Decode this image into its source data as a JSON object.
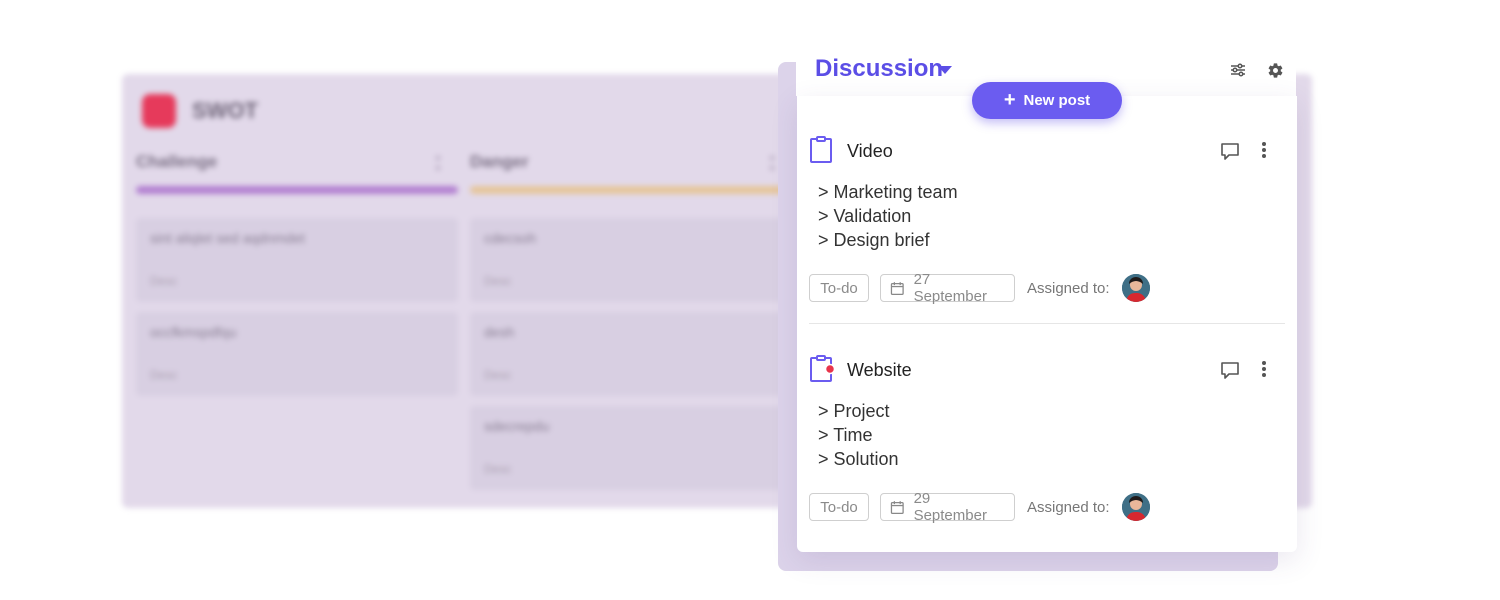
{
  "background_board": {
    "title": "SWOT",
    "columns": [
      {
        "name": "Challenge",
        "color": "#b27fd1",
        "cards": [
          {
            "title": "sint aliqlet sed aqdnmdet",
            "sub": "Desc"
          },
          {
            "title": "occfkmspdfqu",
            "sub": "Desc"
          }
        ]
      },
      {
        "name": "Danger",
        "color": "#e6c59a",
        "cards": [
          {
            "title": "cdecsoh",
            "sub": "Desc"
          },
          {
            "title": "desh",
            "sub": "Desc"
          },
          {
            "title": "sdecrepdu",
            "sub": "Desc"
          }
        ]
      }
    ]
  },
  "panel": {
    "title": "Discussion",
    "new_post_label": "New post",
    "accent": "#5b4ee6",
    "button_color": "#6b5cf0"
  },
  "posts": [
    {
      "title": "Video",
      "has_notification": false,
      "lines": [
        "> Marketing team",
        "> Validation",
        "> Design brief"
      ],
      "status": "To-do",
      "date": "27 September",
      "assigned_label": "Assigned to:"
    },
    {
      "title": "Website",
      "has_notification": true,
      "lines": [
        "> Project",
        "> Time",
        "> Solution"
      ],
      "status": "To-do",
      "date": "29 September",
      "assigned_label": "Assigned to:"
    }
  ],
  "icons": {
    "dropdown": "caret-down-icon",
    "filter": "sliders-icon",
    "settings": "gear-icon",
    "post": "clipboard-icon",
    "comment": "comment-icon",
    "more": "more-vertical-icon",
    "date": "calendar-icon"
  }
}
